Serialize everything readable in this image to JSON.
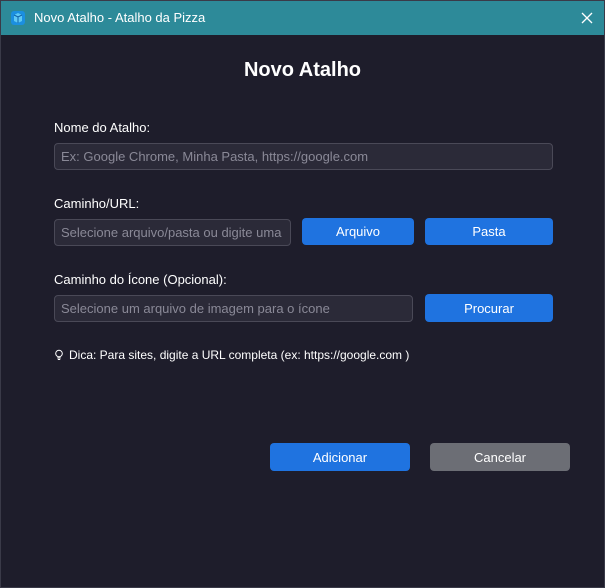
{
  "window": {
    "title": "Novo Atalho - Atalho da Pizza",
    "app_icon": "app-cube-icon",
    "close_icon": "close-icon"
  },
  "form": {
    "heading": "Novo Atalho",
    "name_label": "Nome do Atalho:",
    "name_placeholder": "Ex: Google Chrome, Minha Pasta, https://google.com",
    "path_label": "Caminho/URL:",
    "path_placeholder": "Selecione arquivo/pasta ou digite uma URL",
    "file_button": "Arquivo",
    "folder_button": "Pasta",
    "icon_label": "Caminho do Ícone (Opcional):",
    "icon_placeholder": "Selecione um arquivo de imagem para o ícone",
    "browse_button": "Procurar",
    "tip_icon": "lightbulb-icon",
    "tip_text": "Dica: Para sites, digite a URL completa (ex: https://google.com )",
    "add_button": "Adicionar",
    "cancel_button": "Cancelar"
  },
  "colors": {
    "titlebar": "#2d8a99",
    "background": "#1e1d2b",
    "accent": "#1f73e0",
    "secondary_button": "#6c6e75"
  }
}
